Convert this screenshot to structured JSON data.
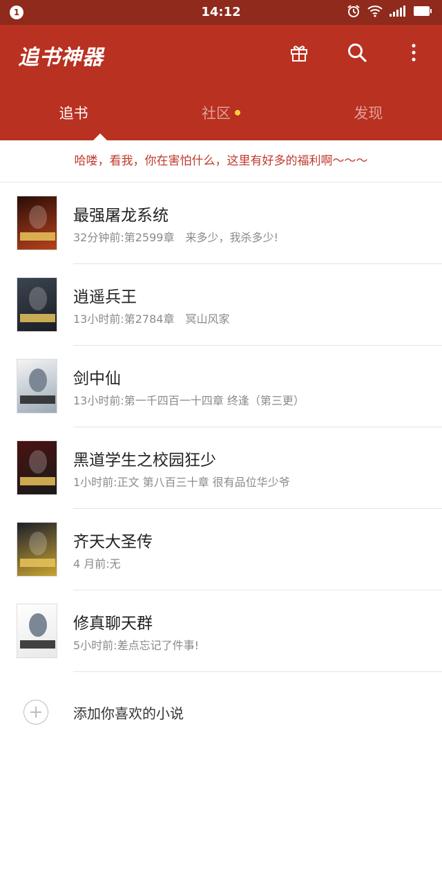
{
  "status_bar": {
    "notification_count": "1",
    "time": "14:12",
    "icons": [
      "alarm-icon",
      "wifi-icon",
      "signal-icon",
      "battery-icon"
    ]
  },
  "header": {
    "app_title": "追书神器",
    "icons": [
      "gift-icon",
      "search-icon",
      "more-vert-icon"
    ],
    "tabs": [
      {
        "label": "追书",
        "active": true
      },
      {
        "label": "社区",
        "badge_dot": true
      },
      {
        "label": "发现"
      }
    ]
  },
  "banner": {
    "text": "哈喽，看我，你在害怕什么，这里有好多的福利啊～～～"
  },
  "books": [
    {
      "title": "最强屠龙系统",
      "subtitle": "32分钟前:第2599章　来多少，我杀多少!",
      "cover_label": "最强屠龙",
      "cover_colors": [
        "#2a0d08",
        "#b8421c"
      ]
    },
    {
      "title": "逍遥兵王",
      "subtitle": "13小时前:第2784章　冥山风家",
      "cover_label": "逍遥兵王",
      "cover_colors": [
        "#3b4450",
        "#1b1e24"
      ]
    },
    {
      "title": "剑中仙",
      "subtitle": "13小时前:第一千四百一十四章 终逢（第三更）",
      "cover_label": "剑中仙",
      "cover_colors": [
        "#f4f4f4",
        "#9aa9b6"
      ]
    },
    {
      "title": "黑道学生之校园狂少",
      "subtitle": "1小时前:正文 第八百三十章 很有品位华少爷",
      "cover_label": "校园狂少",
      "cover_colors": [
        "#4a1212",
        "#1a1a1a"
      ]
    },
    {
      "title": "齐天大圣传",
      "subtitle": "4 月前:无",
      "cover_label": "齐天大圣传",
      "cover_colors": [
        "#1d1f2a",
        "#c9a434"
      ]
    },
    {
      "title": "修真聊天群",
      "subtitle": "5小时前:差点忘记了件事!",
      "cover_label": "修真聊天群",
      "cover_colors": [
        "#ffffff",
        "#e8e8e8"
      ]
    }
  ],
  "add_row": {
    "label": "添加你喜欢的小说"
  },
  "colors": {
    "status_bar": "#8f2a1c",
    "header": "#b93121",
    "banner_text": "#c0392b",
    "badge_dot": "#f6d33a"
  }
}
